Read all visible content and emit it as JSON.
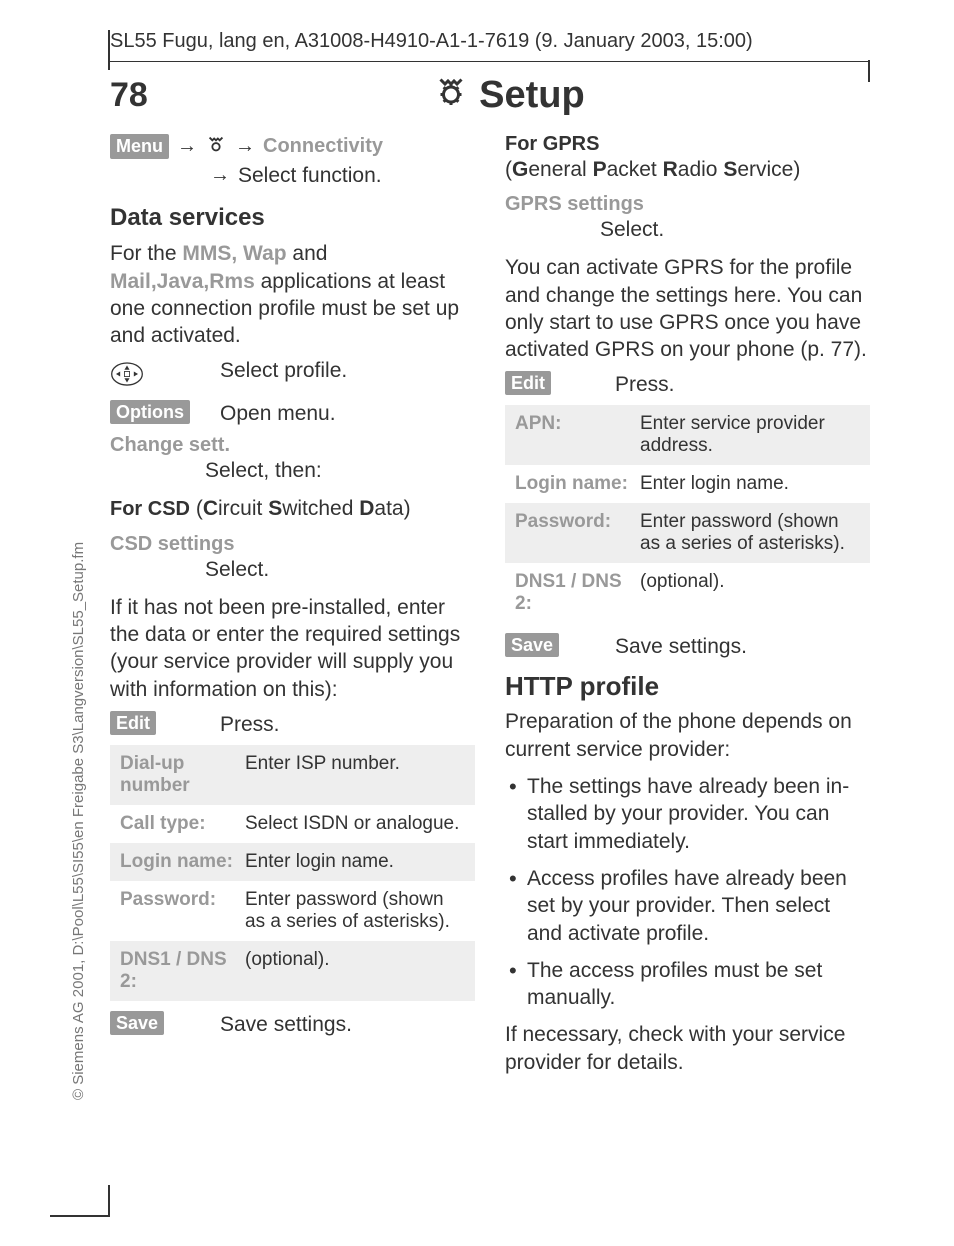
{
  "header": "SL55 Fugu, lang en, A31008-H4910-A1-1-7619 (9. January 2003, 15:00)",
  "pageNumber": "78",
  "title": "Setup",
  "sideText": "© Siemens AG 2001, D:\\Pool\\L55\\SI55\\en Freigabe S3\\Langversion\\SL55_Setup.fm",
  "left": {
    "menuPill": "Menu",
    "connectivity": "Connectivity",
    "selectFunction": "Select function.",
    "dataServices": "Data services",
    "forThe": "For the ",
    "mmsWap": "MMS, Wap",
    "and": " and ",
    "mailJava": "Mail,Java,Rms",
    "appsText": "applications at least one connection profile must be set up and activated.",
    "selectProfile": "Select profile.",
    "optionsPill": "Options",
    "openMenu": "Open menu.",
    "changeSett": "Change sett.",
    "selectThen": "Select, then:",
    "forCsdLabel": "For CSD",
    "csdFull": " (Circuit Switched Data)",
    "csdSettings": "CSD settings",
    "select": "Select.",
    "csdDesc": "If it has not been pre-installed, enter the data or enter the required set­tings (your service provider will sup­ply you with information on this):",
    "editPill": "Edit",
    "press": "Press.",
    "table": [
      {
        "k": "Dial-up number",
        "v": "Enter ISP number."
      },
      {
        "k": "Call type:",
        "v": "Select ISDN or ana­logue."
      },
      {
        "k": "Login name:",
        "v": "Enter login name."
      },
      {
        "k": "Password:",
        "v": "Enter password (shown as a series of asterisks)."
      },
      {
        "k": "DNS1 / DNS 2:",
        "v": "(optional)."
      }
    ],
    "savePill": "Save",
    "saveSettings": "Save settings."
  },
  "right": {
    "forGprs": "For GPRS",
    "gprsFull": "(General Packet Radio Service)",
    "gprsSettings": "GPRS settings",
    "select": "Select.",
    "gprsDesc": "You can activate GPRS for the profile and change the settings here. You can only start to use GPRS once you have activated GPRS on your phone (p. 77).",
    "editPill": "Edit",
    "press": "Press.",
    "table": [
      {
        "k": "APN:",
        "v": "Enter service provider address."
      },
      {
        "k": "Login name:",
        "v": "Enter login name."
      },
      {
        "k": "Password:",
        "v": "Enter password (shown as a series of asterisks)."
      },
      {
        "k": "DNS1 / DNS 2:",
        "v": "(optional)."
      }
    ],
    "savePill": "Save",
    "saveSettings": "Save settings.",
    "httpProfile": "HTTP profile",
    "httpIntro": "Preparation of the phone depends on current service provider:",
    "bullets": [
      "The settings have already been in­stalled by your provider. You can start immediately.",
      "Access profiles have already been set by your provider. Then select and activate profile.",
      "The access profiles must be set manually."
    ],
    "httpOutro": "If necessary, check with your service provider for details."
  }
}
